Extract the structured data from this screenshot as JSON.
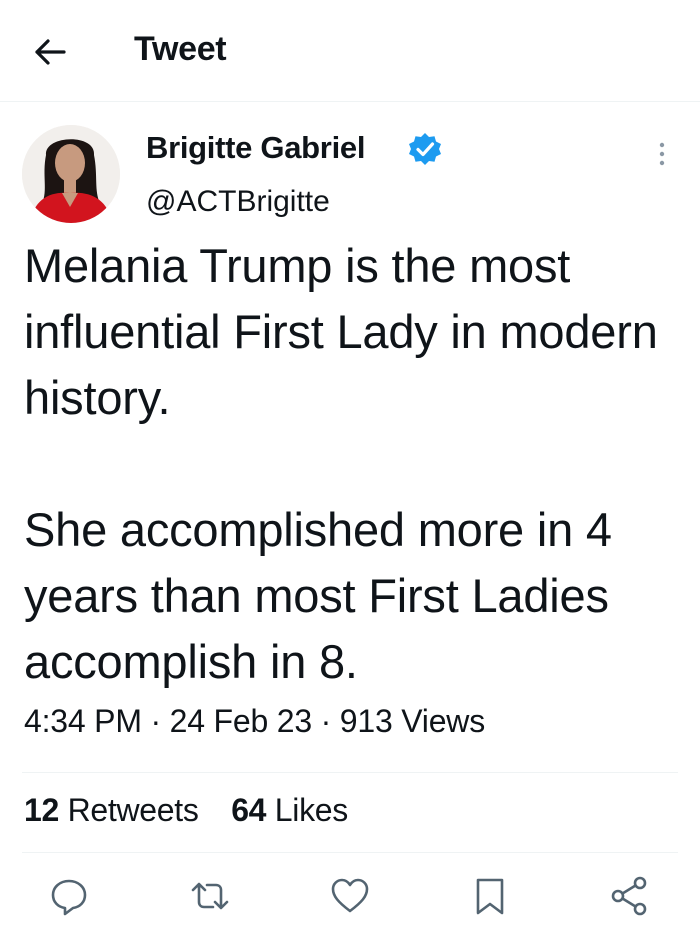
{
  "header": {
    "title": "Tweet",
    "back_icon": "arrow-left-icon"
  },
  "author": {
    "name": "Brigitte Gabriel",
    "handle": "@ACTBrigitte",
    "verified_color": "#1d9bf0"
  },
  "tweet": {
    "paragraphs": [
      "Melania Trump is the most influential First Lady in modern history.",
      "She accomplished more in 4 years than most First Ladies accomplish in 8."
    ],
    "meta": "4:34 PM · 24 Feb 23 · 913 Views"
  },
  "stats": {
    "retweets_count": "12",
    "retweets_label": "Retweets",
    "likes_count": "64",
    "likes_label": "Likes"
  },
  "actions": [
    "reply-icon",
    "retweet-icon",
    "like-icon",
    "bookmark-icon",
    "share-icon"
  ],
  "colors": {
    "text": "#0f1419",
    "divider": "#eff3f4",
    "icon": "#536471",
    "accent": "#1d9bf0"
  }
}
